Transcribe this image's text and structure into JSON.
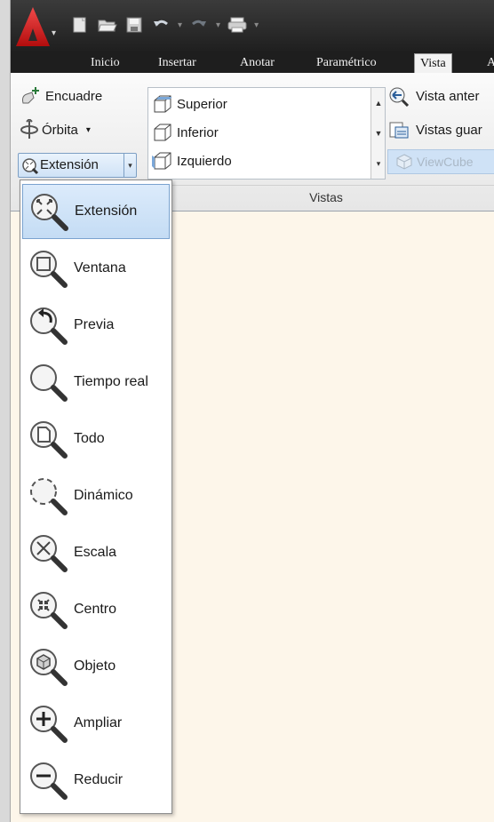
{
  "colors": {
    "accent": "#c4dcf4",
    "title_bg": "#2b2b2b",
    "canvas": "#fdf6ea"
  },
  "qat": {
    "icons": [
      "new-icon",
      "open-icon",
      "save-icon",
      "undo-icon",
      "redo-icon",
      "plot-icon",
      "customize-dropdown-icon"
    ]
  },
  "tabs": [
    "Inicio",
    "Insertar",
    "Anotar",
    "Paramétrico",
    "Vista",
    "A"
  ],
  "active_tab": "Vista",
  "navigate": {
    "pan_label": "Encuadre",
    "orbit_label": "Órbita",
    "orbit_arrow": "▾",
    "extent_label": "Extensión",
    "extent_arrow": "▾"
  },
  "gallery": {
    "items": [
      "Superior",
      "Inferior",
      "Izquierdo"
    ]
  },
  "views_right": {
    "prev_view": "Vista anter",
    "named_views": "Vistas guar",
    "viewcube": "ViewCube"
  },
  "panel_title": "Vistas",
  "zoom_menu": {
    "selected": "Extensión",
    "items": [
      {
        "label": "Extensión",
        "icon": "zoom-extents-icon"
      },
      {
        "label": "Ventana",
        "icon": "zoom-window-icon"
      },
      {
        "label": "Previa",
        "icon": "zoom-previous-icon"
      },
      {
        "label": "Tiempo real",
        "icon": "zoom-realtime-icon"
      },
      {
        "label": "Todo",
        "icon": "zoom-all-icon"
      },
      {
        "label": "Dinámico",
        "icon": "zoom-dynamic-icon"
      },
      {
        "label": "Escala",
        "icon": "zoom-scale-icon"
      },
      {
        "label": "Centro",
        "icon": "zoom-center-icon"
      },
      {
        "label": "Objeto",
        "icon": "zoom-object-icon"
      },
      {
        "label": "Ampliar",
        "icon": "zoom-in-icon"
      },
      {
        "label": "Reducir",
        "icon": "zoom-out-icon"
      }
    ]
  }
}
